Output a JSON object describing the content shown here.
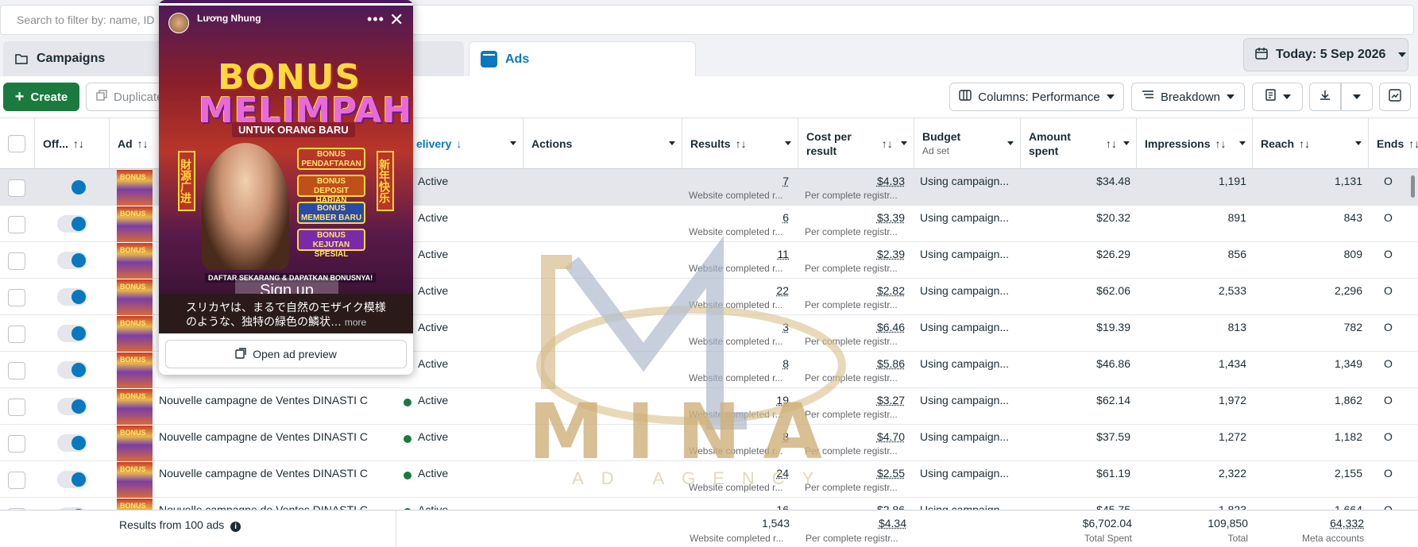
{
  "search": {
    "placeholder": "Search to filter by: name, ID"
  },
  "tabs": [
    {
      "label": "Campaigns",
      "icon": "folder-icon"
    },
    {
      "label": "Ads",
      "icon": "ads-icon"
    }
  ],
  "date_button": {
    "label": "Today: 5 Sep 2026"
  },
  "toolbar": {
    "create_label": "Create",
    "duplicate_label": "Duplicate",
    "columns_label": "Columns: Performance",
    "breakdown_label": "Breakdown"
  },
  "headers": {
    "off_on": "Off...",
    "ad": "Ad",
    "delivery": "elivery",
    "actions": "Actions",
    "results": "Results",
    "cost_line1": "Cost per",
    "cost_line2": "result",
    "budget": "Budget",
    "budget_sub": "Ad set",
    "amount_line1": "Amount",
    "amount_line2": "spent",
    "impressions": "Impressions",
    "reach": "Reach",
    "ends": "Ends"
  },
  "rows": [
    {
      "name": "",
      "delivery": "Active",
      "results": "7",
      "results_sub": "Website completed r...",
      "cost": "$4.93",
      "cost_sub": "Per complete registr...",
      "budget": "Using campaign...",
      "amount": "$34.48",
      "impressions": "1,191",
      "reach": "1,131",
      "ends": "O"
    },
    {
      "name": "",
      "delivery": "Active",
      "results": "6",
      "results_sub": "Website completed r...",
      "cost": "$3.39",
      "cost_sub": "Per complete registr...",
      "budget": "Using campaign...",
      "amount": "$20.32",
      "impressions": "891",
      "reach": "843",
      "ends": "O"
    },
    {
      "name": "",
      "delivery": "Active",
      "results": "11",
      "results_sub": "Website completed r...",
      "cost": "$2.39",
      "cost_sub": "Per complete registr...",
      "budget": "Using campaign...",
      "amount": "$26.29",
      "impressions": "856",
      "reach": "809",
      "ends": "O"
    },
    {
      "name": "",
      "delivery": "Active",
      "results": "22",
      "results_sub": "Website completed r...",
      "cost": "$2.82",
      "cost_sub": "Per complete registr...",
      "budget": "Using campaign...",
      "amount": "$62.06",
      "impressions": "2,533",
      "reach": "2,296",
      "ends": "O"
    },
    {
      "name": "",
      "delivery": "Active",
      "results": "3",
      "results_sub": "Website completed r...",
      "cost": "$6.46",
      "cost_sub": "Per complete registr...",
      "budget": "Using campaign...",
      "amount": "$19.39",
      "impressions": "813",
      "reach": "782",
      "ends": "O"
    },
    {
      "name": "",
      "delivery": "Active",
      "results": "8",
      "results_sub": "Website completed r...",
      "cost": "$5.86",
      "cost_sub": "Per complete registr...",
      "budget": "Using campaign...",
      "amount": "$46.86",
      "impressions": "1,434",
      "reach": "1,349",
      "ends": "O"
    },
    {
      "name": "Nouvelle campagne de Ventes DINASTI C",
      "delivery": "Active",
      "results": "19",
      "results_sub": "Website completed r...",
      "cost": "$3.27",
      "cost_sub": "Per complete registr...",
      "budget": "Using campaign...",
      "amount": "$62.14",
      "impressions": "1,972",
      "reach": "1,862",
      "ends": "O"
    },
    {
      "name": "Nouvelle campagne de Ventes DINASTI C",
      "delivery": "Active",
      "results": "8",
      "results_sub": "Website completed r...",
      "cost": "$4.70",
      "cost_sub": "Per complete registr...",
      "budget": "Using campaign...",
      "amount": "$37.59",
      "impressions": "1,272",
      "reach": "1,182",
      "ends": "O"
    },
    {
      "name": "Nouvelle campagne de Ventes DINASTI C",
      "delivery": "Active",
      "results": "24",
      "results_sub": "Website completed r...",
      "cost": "$2.55",
      "cost_sub": "Per complete registr...",
      "budget": "Using campaign...",
      "amount": "$61.19",
      "impressions": "2,322",
      "reach": "2,155",
      "ends": "O"
    },
    {
      "name": "Nouvelle campagne de Ventes DINASTI C",
      "delivery": "Active",
      "results": "16",
      "results_sub": "",
      "cost": "$2.86",
      "cost_sub": "",
      "budget": "Using campaign...",
      "amount": "$45.75",
      "impressions": "1,823",
      "reach": "1,664",
      "ends": "O"
    }
  ],
  "footer": {
    "label": "Results from 100 ads",
    "results": "1,543",
    "results_sub": "Website completed r...",
    "cost": "$4.34",
    "cost_sub": "Per complete registr...",
    "amount": "$6,702.04",
    "amount_sub": "Total Spent",
    "impressions": "109,850",
    "impressions_sub": "Total",
    "reach": "64,332",
    "reach_sub": "Meta accounts"
  },
  "popup": {
    "user": "Lương Nhung",
    "headline1": "BONUS",
    "headline2": "MELIMPAH",
    "subhead": "UNTUK ORANG BARU",
    "bonus_items": [
      "BONUS PENDAFTARAN",
      "BONUS DEPOSIT HARIAN",
      "BONUS MEMBER BARU",
      "BONUS KEJUTAN SPESIAL"
    ],
    "side_left": "財源广进",
    "side_right": "新年快乐",
    "footer_text": "DAFTAR SEKARANG & DAPATKAN BONUSNYA!",
    "signup": "Sign up",
    "caption": "スリカヤは、まるで自然のモザイク模様のような、独特の緑色の鱗状…",
    "more": "more",
    "open_preview": "Open ad preview"
  },
  "watermark": {
    "text": "MINA",
    "sub": "AD AGENCY"
  },
  "colors": {
    "accent": "#0a78be",
    "create_green": "#1b7a3e",
    "active_dot": "#1b7a3e"
  }
}
